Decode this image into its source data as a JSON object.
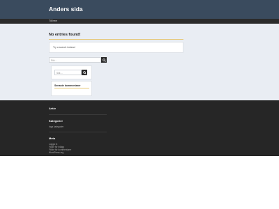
{
  "header": {
    "site_title": "Anders sida"
  },
  "nav": {
    "link": "Till hem"
  },
  "main": {
    "page_title": "No entries found!",
    "notice": "Try a search instead",
    "search_placeholder": "Sök ..."
  },
  "sidebar": {
    "search_placeholder": "Sök ...",
    "recent_comments_title": "Senaste kommentarer"
  },
  "footer": {
    "archive_title": "Arkiv",
    "categories_title": "Kategorier",
    "categories_empty": "Inga kategorier",
    "meta_title": "Meta",
    "meta_items": [
      "Logga in",
      "Flöde för inlägg",
      "Flöde för kommentarer",
      "WordPress.org"
    ]
  },
  "colors": {
    "header": "#3a4b5e",
    "content_bg": "#e9edf3",
    "footer": "#262626",
    "accent": "#e6c776"
  },
  "icons": {
    "search": "search-icon"
  }
}
